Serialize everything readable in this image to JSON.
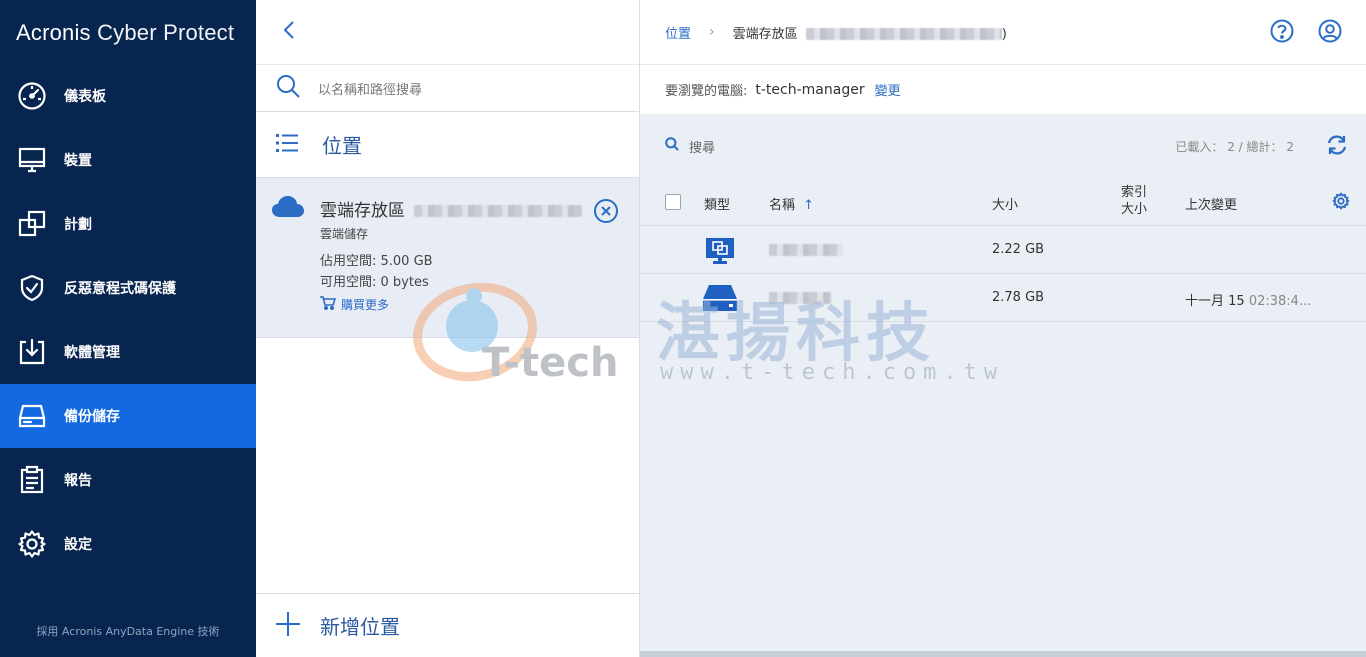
{
  "app": {
    "brand_primary": "Acronis",
    "brand_secondary": "Cyber Protect",
    "footer": "採用 Acronis AnyData Engine 技術"
  },
  "colors": {
    "sidebar_bg": "#08254f",
    "active_bg": "#1369e0",
    "accent": "#2b6cc4"
  },
  "sidebar": {
    "items": [
      {
        "label": "儀表板",
        "icon": "dashboard-icon"
      },
      {
        "label": "裝置",
        "icon": "monitor-icon"
      },
      {
        "label": "計劃",
        "icon": "plans-icon"
      },
      {
        "label": "反惡意程式碼保護",
        "icon": "shield-icon"
      },
      {
        "label": "軟體管理",
        "icon": "download-icon"
      },
      {
        "label": "備份儲存",
        "icon": "storage-icon",
        "active": true
      },
      {
        "label": "報告",
        "icon": "clipboard-icon"
      },
      {
        "label": "設定",
        "icon": "gear-icon"
      }
    ]
  },
  "middle": {
    "search_placeholder": "以名稱和路徑搜尋",
    "section_title": "位置",
    "location": {
      "name": "雲端存放區",
      "type": "雲端儲存",
      "used": "佔用空間: 5.00 GB",
      "free": "可用空間: 0 bytes",
      "buy_more": "購買更多"
    },
    "add_location": "新增位置"
  },
  "watermark": {
    "brand": "T-tech",
    "cn": "湛揚科技",
    "url": "www.t-tech.com.tw"
  },
  "right": {
    "breadcrumb_root": "位置",
    "breadcrumb_current": "雲端存放區",
    "breadcrumb_close": ")",
    "browse_key": "要瀏覽的電腦:",
    "browse_value": "t-tech-manager",
    "browse_change": "變更",
    "search_label": "搜尋",
    "counts": "已載入： 2 / 總計： 2",
    "columns": {
      "type": "類型",
      "name": "名稱",
      "size": "大小",
      "index_size_1": "索引",
      "index_size_2": "大小",
      "last_change": "上次變更"
    },
    "rows": [
      {
        "icon": "machine-copy-icon",
        "size": "2.22 GB",
        "changed_date": "",
        "changed_time": ""
      },
      {
        "icon": "drive-icon",
        "size": "2.78 GB",
        "changed_date": "十一月 15",
        "changed_time": "02:38:4..."
      }
    ]
  }
}
